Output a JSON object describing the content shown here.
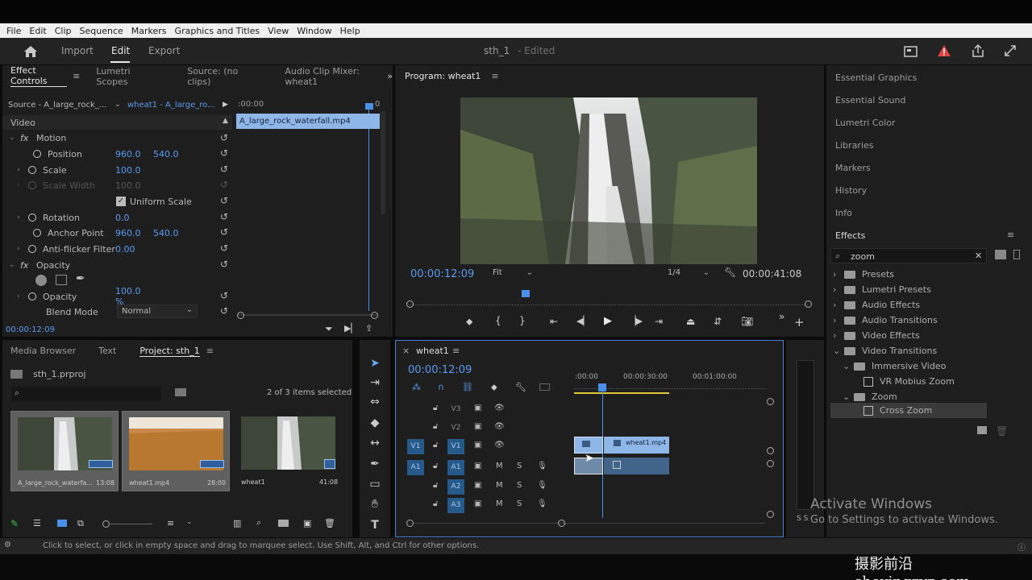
{
  "menu": [
    "File",
    "Edit",
    "Clip",
    "Sequence",
    "Markers",
    "Graphics and Titles",
    "View",
    "Window",
    "Help"
  ],
  "header": {
    "nav": [
      "Import",
      "Edit",
      "Export"
    ],
    "active_nav": "Edit",
    "doc_title": "sth_1",
    "doc_status": "- Edited"
  },
  "effect_controls": {
    "tabs": [
      "Effect Controls",
      "Lumetri Scopes",
      "Source: (no clips)",
      "Audio Clip Mixer: wheat1"
    ],
    "source_label": "Source - A_large_rock_...",
    "clip_label": "wheat1 - A_large_ro...",
    "time_start": ":00:00",
    "time_end": "0",
    "clip_bar_label": "A_large_rock_waterfall.mp4",
    "section_video": "Video",
    "motion": "Motion",
    "fx_label": "fx",
    "position_label": "Position",
    "position_x": "960.0",
    "position_y": "540.0",
    "scale_label": "Scale",
    "scale_value": "100.0",
    "scale_width_label": "Scale Width",
    "scale_width_value": "100.0",
    "uniform_scale_label": "Uniform Scale",
    "rotation_label": "Rotation",
    "rotation_value": "0.0",
    "anchor_label": "Anchor Point",
    "anchor_x": "960.0",
    "anchor_y": "540.0",
    "antiflicker_label": "Anti-flicker Filter",
    "antiflicker_value": "0.00",
    "opacity_section": "Opacity",
    "opacity_label": "Opacity",
    "opacity_value": "100.0 %",
    "blend_label": "Blend Mode",
    "blend_value": "Normal",
    "current_time": "00:00:12:09"
  },
  "program": {
    "title": "Program: wheat1",
    "timecode": "00:00:12:09",
    "fit": "Fit",
    "resolution": "1/4",
    "duration": "00:00:41:08"
  },
  "right_panels": {
    "items": [
      "Essential Graphics",
      "Essential Sound",
      "Lumetri Color",
      "Libraries",
      "Markers",
      "History",
      "Info"
    ],
    "effects_title": "Effects",
    "search_value": "zoom",
    "tree": [
      "Presets",
      "Lumetri Presets",
      "Audio Effects",
      "Audio Transitions",
      "Video Effects",
      "Video Transitions",
      "Immersive Video",
      "VR Mobius Zoom",
      "Zoom",
      "Cross Zoom"
    ]
  },
  "project": {
    "tabs": [
      "Media Browser",
      "Text",
      "Project: sth_1"
    ],
    "file_name": "sth_1.prproj",
    "selection_info": "2 of 3 items selected",
    "items": [
      {
        "name": "A_large_rock_waterfa...",
        "duration": "13:08"
      },
      {
        "name": "wheat1.mp4",
        "duration": "28:00"
      },
      {
        "name": "wheat1",
        "duration": "41:08"
      }
    ]
  },
  "timeline": {
    "sequence_name": "wheat1",
    "timecode": "00:00:12:09",
    "ruler": [
      ":00:00",
      "00:00:30:00",
      "00:01:00:00"
    ],
    "video_tracks": [
      "V3",
      "V2",
      "V1"
    ],
    "audio_tracks": [
      "A1",
      "A2",
      "A3"
    ],
    "source_v": "V1",
    "source_a": "A1",
    "clip_label": "wheat1.mp4",
    "mute": "M",
    "solo": "S"
  },
  "meter": {
    "label": "S S"
  },
  "status": {
    "text": "Click to select, or click in empty space and drag to marquee select. Use Shift, Alt, and Ctrl for other options."
  },
  "watermarks": {
    "activate_title": "Activate Windows",
    "activate_sub": "Go to Settings to activate Windows.",
    "brand": "摄影前沿 sheyingzyz.com"
  },
  "colors": {
    "accent": "#5a9bf0",
    "track_on": "#265a8a",
    "clip": "#8eb6e6",
    "panel": "#1e1e1e"
  }
}
